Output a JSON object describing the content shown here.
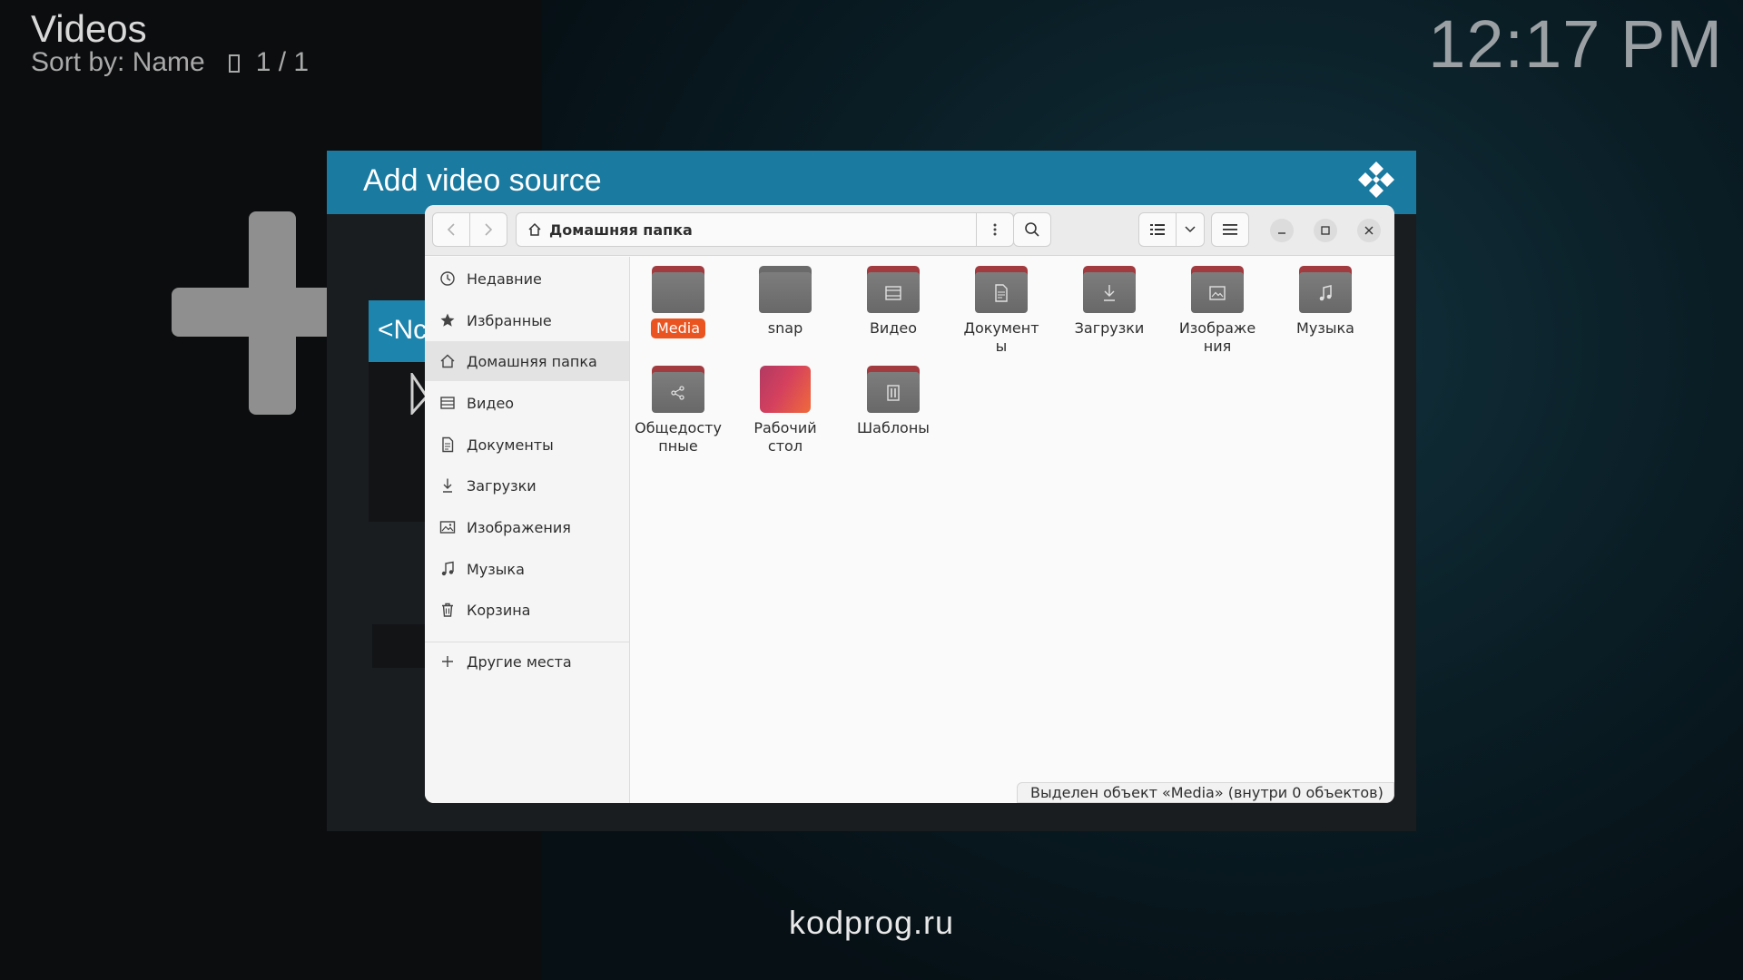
{
  "kodi": {
    "title": "Videos",
    "sort_label": "Sort by: Name",
    "page_count": "1 / 1",
    "clock": "12:17 PM",
    "dialog_title": "Add video source",
    "list_item_partial": "<Nc"
  },
  "file_manager": {
    "path": "Домашняя папка",
    "sidebar": [
      {
        "label": "Недавние",
        "icon": "clock-icon"
      },
      {
        "label": "Избранные",
        "icon": "star-icon"
      },
      {
        "label": "Домашняя папка",
        "icon": "home-icon",
        "active": true
      },
      {
        "label": "Видео",
        "icon": "film-icon"
      },
      {
        "label": "Документы",
        "icon": "document-icon"
      },
      {
        "label": "Загрузки",
        "icon": "download-icon"
      },
      {
        "label": "Изображения",
        "icon": "image-icon"
      },
      {
        "label": "Музыка",
        "icon": "music-icon"
      },
      {
        "label": "Корзина",
        "icon": "trash-icon"
      }
    ],
    "other_places": "Другие места",
    "items": [
      {
        "label": "Media",
        "selected": true,
        "tab_color": "#a13b3f"
      },
      {
        "label": "snap",
        "tab_color": "#6a6a6a"
      },
      {
        "label": "Видео",
        "emblem": "film-icon",
        "tab_color": "#a13b3f"
      },
      {
        "label_line1": "Документ",
        "label_line2": "ы",
        "emblem": "document-icon",
        "tab_color": "#a13b3f"
      },
      {
        "label": "Загрузки",
        "emblem": "download-icon",
        "tab_color": "#a13b3f"
      },
      {
        "label_line1": "Изображе",
        "label_line2": "ния",
        "emblem": "image-icon",
        "tab_color": "#a13b3f"
      },
      {
        "label": "Музыка",
        "emblem": "music-icon",
        "tab_color": "#a13b3f"
      },
      {
        "label_line1": "Общедосту",
        "label_line2": "пные",
        "emblem": "share-icon",
        "tab_color": "#a13b3f"
      },
      {
        "label_line1": "Рабочий",
        "label_line2": "стол",
        "emblem": "desktop-icon"
      },
      {
        "label": "Шаблоны",
        "emblem": "template-icon",
        "tab_color": "#a13b3f"
      }
    ],
    "status": "Выделен объект «Media» (внутри 0 объектов)"
  },
  "watermark": "kodprog.ru",
  "colors": {
    "kodi_header": "#1a7aa0",
    "selection": "#e95420",
    "folder_tab": "#a13b3f"
  }
}
